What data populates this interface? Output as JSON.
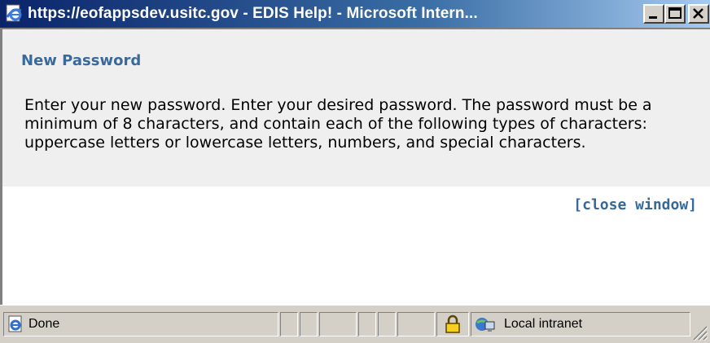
{
  "window": {
    "title": "https://eofappsdev.usitc.gov - EDIS Help! - Microsoft Intern...",
    "controls": [
      "minimize",
      "maximize",
      "close"
    ]
  },
  "content": {
    "heading": "New Password",
    "body": "Enter your new password. Enter your desired password. The password must be a minimum of 8 characters, and contain each of the following types of characters: uppercase letters or lowercase letters, numbers, and special characters.",
    "close_link": "[close window]"
  },
  "statusbar": {
    "status": "Done",
    "zone": "Local intranet"
  },
  "icons": {
    "title": "ie-page-icon",
    "status": "ie-page-icon",
    "lock": "lock-icon",
    "zone": "intranet-icon"
  },
  "colors": {
    "titlebar_start": "#0a246a",
    "titlebar_end": "#a6caf0",
    "heading": "#3a6a9a",
    "link": "#36689a"
  }
}
